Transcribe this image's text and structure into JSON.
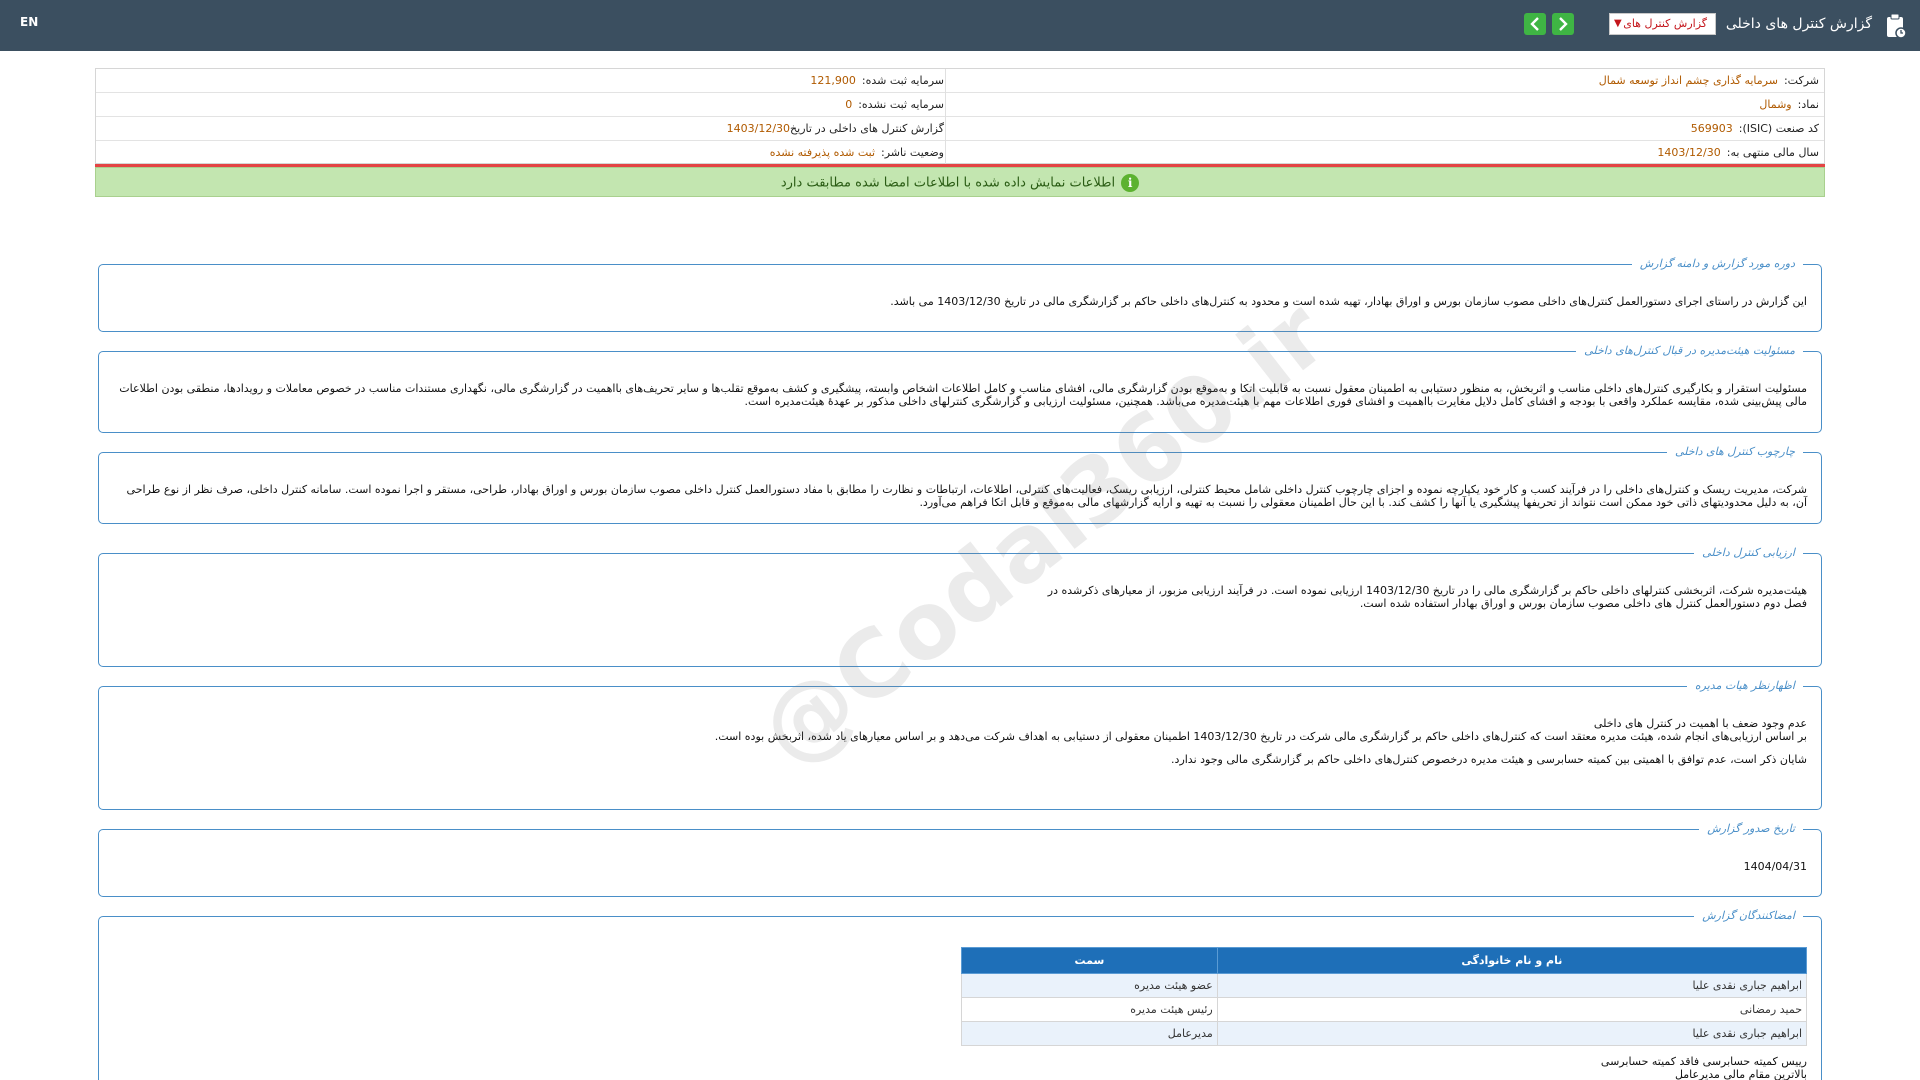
{
  "header": {
    "title": "گزارش کنترل های داخلی",
    "report_select": "گزارش کنترل های",
    "lang": "EN"
  },
  "info": {
    "company_label": "شرکت:",
    "company_value": "سرمایه گذاری چشم انداز توسعه شمال",
    "registered_capital_label": "سرمایه ثبت شده:",
    "registered_capital_value": "121,900",
    "symbol_label": "نماد:",
    "symbol_value": "وشمال",
    "unregistered_capital_label": "سرمایه ثبت نشده:",
    "unregistered_capital_value": "0",
    "isic_label": "کد صنعت (ISIC):",
    "isic_value": "569903",
    "report_date_label": "گزارش کنترل های داخلی در تاریخ",
    "report_date_value": "1403/12/30",
    "fiscal_year_label": "سال مالی منتهی به:",
    "fiscal_year_value": "1403/12/30",
    "publisher_status_label": "وضعیت ناشر:",
    "publisher_status_value": "ثبت شده پذیرفته نشده"
  },
  "banner": "اطلاعات نمایش داده شده با اطلاعات امضا شده مطابقت دارد",
  "sections": {
    "period": {
      "legend": "دوره مورد گزارش و دامنه گزارش",
      "text": "این گزارش در راستای اجرای دستورالعمل کنترل‌های داخلی مصوب سازمان بورس و اوراق بهادار، تهیه شده است و محدود به کنترل‌های داخلی حاکم بر گزارشگری مالی در تاریخ 1403/12/30 می باشد."
    },
    "board_responsibility": {
      "legend": "مسئولیت هیئت‌مدیره در قبال کنترل‌های داخلی",
      "text": "مسئولیت استقرار و بکارگیری کنترل‌های داخلی مناسب و اثربخش، به منظور دستیابی به اطمینان معقول نسبت به قابلیت اتکا و به‌موقع بودن گزارشگری مالی، افشای مناسب و کامل اطلاعات اشخاص وابسته، پیشگیری و کشف به‌موقع تقلب‌ها و سایر تحریف‌های بااهمیت در گزارشگری مالی، نگهداری مستندات مناسب در خصوص معاملات و رویدادها، منطقی بودن اطلاعات مالی پیش‌بینی شده، مقایسه عملکرد واقعی با بودجه و افشای کامل دلایل مغایرت بااهمیت و افشای فوری اطلاعات مهم با هیئت‌مدیره می‌باشد. همچنین، مسئولیت ارزیابی و گزارشگری کنترلهای داخلی مذکور بر عهدهٔ هیئت‌مدیره است."
    },
    "framework": {
      "legend": "چارچوب کنترل های داخلی",
      "text": "شرکت، مدیریت ریسک و کنترل‌های داخلی را در فرآیند کسب و کار خود یکپارچه نموده و اجزای چارچوب کنترل داخلی شامل محیط کنترلی، ارزیابی ریسک، فعالیت‌های کنترلی، اطلاعات، ارتباطات و نظارت را مطابق با مفاد دستورالعمل کنترل داخلی مصوب سازمان بورس و اوراق بهادار، طراحی، مستقر و اجرا نموده است. سامانه کنترل داخلی، صرف نظر از نوع طراحی آن، به دلیل محدودیتهای ذاتی خود ممکن است نتواند از تحریفها پیشگیری یا آنها را کشف کند. با این حال اطمینان معقولی را نسبت به تهیه و ارایه گزارشهای مالی به‌موقع و قابل اتکا فراهم می‌آورد."
    },
    "evaluation": {
      "legend": "ارزیابی کنترل داخلی",
      "line1": "هیئت‌مدیره شرکت، اثربخشی کنترلهای داخلی حاکم بر گزارشگری مالی را در تاریخ 1403/12/30 ارزیابی نموده است. در فرآیند ارزیابی مزبور، از معیارهای ذکرشده در",
      "line2": "فصل دوم دستورالعمل کنترل های داخلی مصوب سازمان بورس و اوراق بهادار استفاده شده است."
    },
    "board_opinion": {
      "legend": "اظهارنظر هیات مدیره",
      "line1": "عدم وجود ضعف با اهمیت در کنترل های داخلی",
      "line2": "بر اساس ارزیابی‌های انجام شده، هیئت مدیره معتقد است که کنترل‌های داخلی حاکم بر گزارشگری مالی شرکت در تاریخ 1403/12/30 اطمینان معقولی از دستیابی به اهداف شرکت می‌دهد و بر اساس معیارهای یاد شده، اثربخش بوده است.",
      "line3": "شایان ذکر است، عدم توافق با اهمیتی بین کمیته حسابرسی و هیئت مدیره درخصوص کنترل‌های داخلی حاکم بر گزارشگری مالی وجود ندارد."
    },
    "issue_date": {
      "legend": "تاریخ صدور گزارش",
      "value": "1404/04/31"
    },
    "signers": {
      "legend": "امضاکنندگان گزارش",
      "col_name": "نام و نام خانوادگی",
      "col_role": "سمت",
      "rows": [
        {
          "name": "ابراهیم جباری نقدی علیا",
          "role": "عضو هیئت مدیره"
        },
        {
          "name": "حمید رمضانی",
          "role": "رئیس هیئت مدیره"
        },
        {
          "name": "ابراهیم جباری نقدی علیا",
          "role": "مدیرعامل"
        }
      ],
      "extra_line1": "رییس کمیته حسابرسی فاقد کمیته حسابرسی",
      "extra_line2": "بالاترین مقام مالی   مدیرعامل"
    }
  },
  "watermark": "@Codal360.ir"
}
